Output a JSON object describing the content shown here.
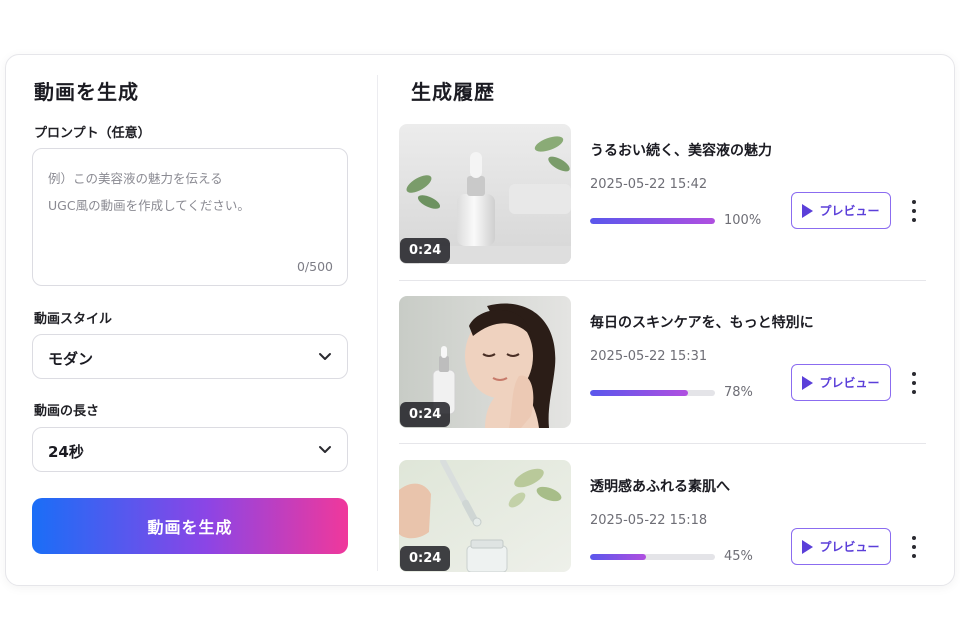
{
  "generate_panel": {
    "title": "動画を生成",
    "prompt_label": "プロンプト（任意）",
    "prompt_placeholder": "例）この美容液の魅力を伝える\nUGC風の動画を作成してください。",
    "prompt_value": "",
    "char_counter": "0/500",
    "style_label": "動画スタイル",
    "style_value": "モダン",
    "length_label": "動画の長さ",
    "length_value": "24秒",
    "generate_button": "動画を生成"
  },
  "history": {
    "title": "生成履歴",
    "items": [
      {
        "title": "うるおい続く、美容液の魅力",
        "timestamp": "2025-05-22 15:42",
        "progress": 100,
        "progress_label": "100%",
        "duration": "0:24",
        "preview_label": "プレビュー",
        "thumbnail": "serum-bottle-with-leaves"
      },
      {
        "title": "毎日のスキンケアを、もっと特別に",
        "timestamp": "2025-05-22 15:31",
        "progress": 78,
        "progress_label": "78%",
        "duration": "0:24",
        "preview_label": "プレビュー",
        "thumbnail": "woman-applying-skincare"
      },
      {
        "title": "透明感あふれる素肌へ",
        "timestamp": "2025-05-22 15:18",
        "progress": 45,
        "progress_label": "45%",
        "duration": "0:24",
        "preview_label": "プレビュー",
        "thumbnail": "dropper-serum-closeup"
      }
    ]
  },
  "colors": {
    "accent_gradient": [
      "#1a6ef7",
      "#8b45e6",
      "#f0389b"
    ],
    "progress_gradient": [
      "#5a57ec",
      "#b04fe0"
    ],
    "preview_border": "#8b6cf0"
  }
}
